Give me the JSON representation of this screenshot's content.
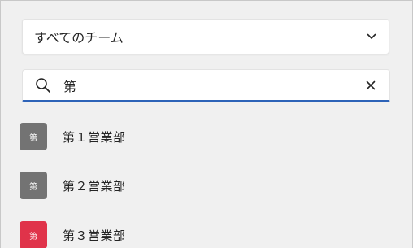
{
  "team_filter": {
    "selected": "すべてのチーム",
    "icon": "chevron-down-icon"
  },
  "search": {
    "value": "第",
    "search_icon": "search-icon",
    "clear_icon": "close-icon"
  },
  "teams": [
    {
      "avatar_text": "第",
      "name": "第１営業部",
      "color": "#737373"
    },
    {
      "avatar_text": "第",
      "name": "第２営業部",
      "color": "#737373"
    },
    {
      "avatar_text": "第",
      "name": "第３営業部",
      "color": "#e0334a"
    }
  ],
  "colors": {
    "background": "#f0f0f0",
    "accent": "#2d63b8"
  }
}
